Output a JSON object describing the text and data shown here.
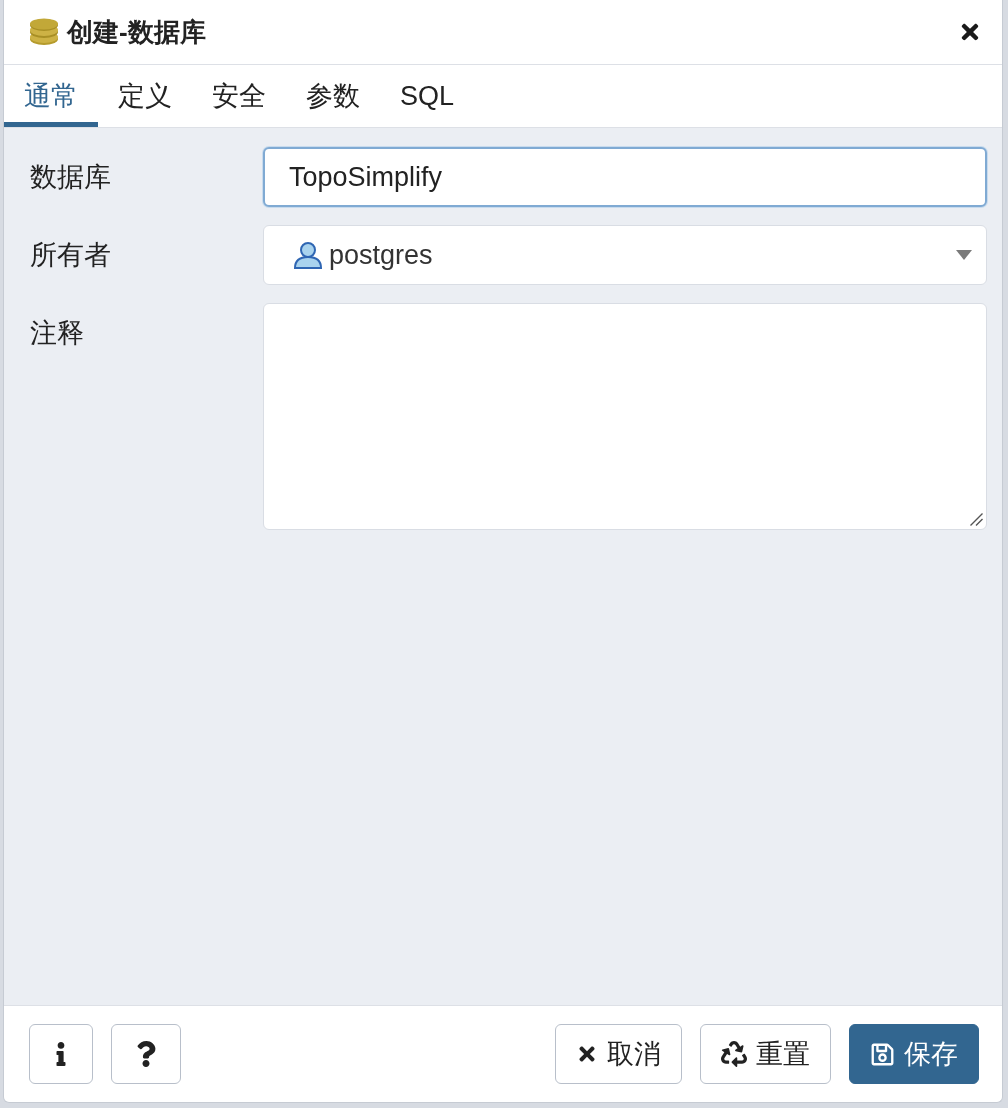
{
  "dialog": {
    "title": "创建-数据库"
  },
  "tabs": [
    {
      "label": "通常",
      "selected": true
    },
    {
      "label": "定义",
      "selected": false
    },
    {
      "label": "安全",
      "selected": false
    },
    {
      "label": "参数",
      "selected": false
    },
    {
      "label": "SQL",
      "selected": false
    }
  ],
  "fields": [
    {
      "kind": "text",
      "label": "数据库",
      "value": "TopoSimplify",
      "focused": true
    },
    {
      "kind": "select",
      "label": "所有者",
      "value": "postgres",
      "focused": false
    },
    {
      "kind": "textarea",
      "label": "注释",
      "focused": false
    }
  ],
  "footer": {
    "left_buttons": [
      {
        "kind": "info"
      },
      {
        "kind": "help"
      }
    ],
    "right_buttons": [
      {
        "kind": "cancel",
        "label": "取消",
        "primary": false
      },
      {
        "kind": "reset",
        "label": "重置",
        "primary": false
      },
      {
        "kind": "save",
        "label": "保存",
        "primary": true
      }
    ]
  }
}
